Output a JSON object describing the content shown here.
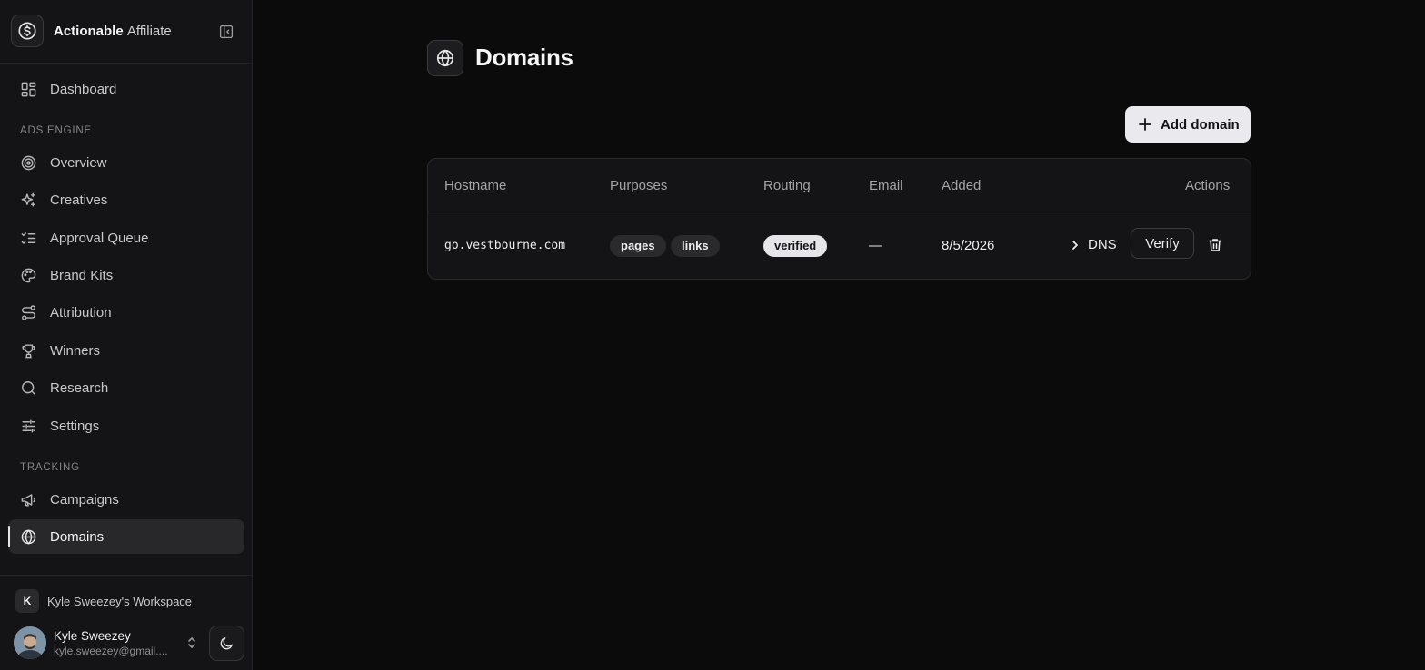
{
  "brand": {
    "name_bold": "Actionable",
    "name_light": "Affiliate"
  },
  "sidebar": {
    "dashboard": "Dashboard",
    "section_ads": "ADS ENGINE",
    "ads_items": [
      {
        "label": "Overview",
        "icon": "target-icon"
      },
      {
        "label": "Creatives",
        "icon": "sparkles-icon"
      },
      {
        "label": "Approval Queue",
        "icon": "list-checks-icon"
      },
      {
        "label": "Brand Kits",
        "icon": "palette-icon"
      },
      {
        "label": "Attribution",
        "icon": "route-icon"
      },
      {
        "label": "Winners",
        "icon": "trophy-icon"
      },
      {
        "label": "Research",
        "icon": "search-icon"
      },
      {
        "label": "Settings",
        "icon": "sliders-icon"
      }
    ],
    "section_tracking": "TRACKING",
    "tracking_items": [
      {
        "label": "Campaigns",
        "icon": "megaphone-icon"
      },
      {
        "label": "Domains",
        "icon": "globe-icon",
        "active": true
      }
    ]
  },
  "workspace": {
    "badge": "K",
    "name": "Kyle Sweezey's Workspace"
  },
  "user": {
    "name": "Kyle Sweezey",
    "email": "kyle.sweezey@gmail...."
  },
  "page": {
    "title": "Domains",
    "add_label": "Add domain"
  },
  "table": {
    "headers": {
      "hostname": "Hostname",
      "purposes": "Purposes",
      "routing": "Routing",
      "email": "Email",
      "added": "Added",
      "actions": "Actions"
    },
    "rows": [
      {
        "hostname": "go.vestbourne.com",
        "purposes": [
          "pages",
          "links"
        ],
        "routing": "verified",
        "email": "—",
        "added": "8/5/2026",
        "dns_label": "DNS",
        "verify_label": "Verify"
      }
    ]
  },
  "colors": {
    "background": "#0b0b0c",
    "sidebar": "#141416",
    "accent_button": "#e9e9ee"
  }
}
